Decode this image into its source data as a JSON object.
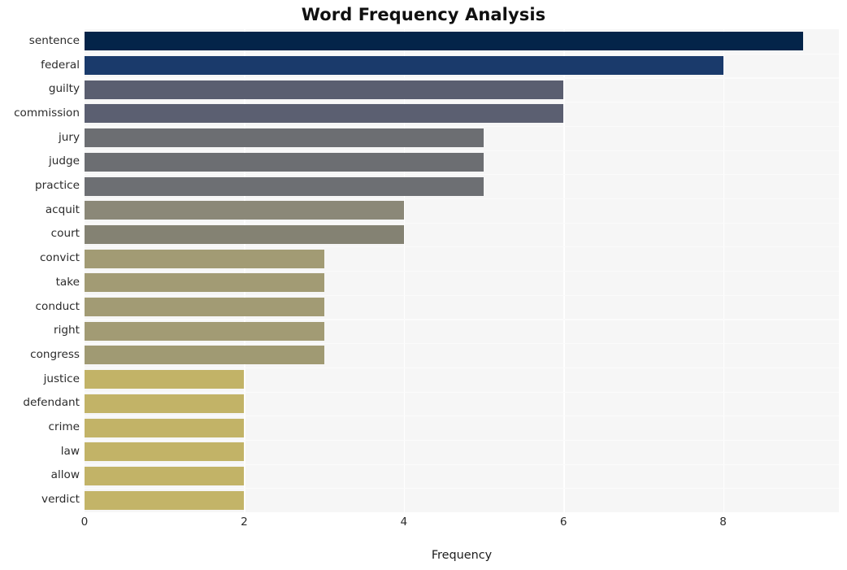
{
  "chart_data": {
    "type": "bar",
    "orientation": "horizontal",
    "title": "Word Frequency Analysis",
    "xlabel": "Frequency",
    "ylabel": "",
    "categories": [
      "sentence",
      "federal",
      "guilty",
      "commission",
      "jury",
      "judge",
      "practice",
      "acquit",
      "court",
      "convict",
      "take",
      "conduct",
      "right",
      "congress",
      "justice",
      "defendant",
      "crime",
      "law",
      "allow",
      "verdict"
    ],
    "values": [
      9,
      8,
      6,
      6,
      5,
      5,
      5,
      4,
      4,
      3,
      3,
      3,
      3,
      3,
      2,
      2,
      2,
      2,
      2,
      2
    ],
    "bar_colors": [
      "#042449",
      "#1a3a6b",
      "#5a5e70",
      "#5b5f71",
      "#6c6e72",
      "#6c6e72",
      "#6d6f73",
      "#8b8878",
      "#848273",
      "#a29b74",
      "#a29b74",
      "#a29b74",
      "#a29b74",
      "#a09a73",
      "#c2b367",
      "#c2b367",
      "#c2b367",
      "#c2b367",
      "#c2b367",
      "#c3b468"
    ],
    "xlim": [
      0,
      9.45
    ],
    "xticks": [
      0,
      2,
      4,
      6,
      8
    ],
    "xticklabels": [
      "0",
      "2",
      "4",
      "6",
      "8"
    ],
    "grid": true,
    "grid_color": "#ffffff",
    "plot_background": "#f6f6f6",
    "figure_background": "#ffffff",
    "legend": null
  }
}
